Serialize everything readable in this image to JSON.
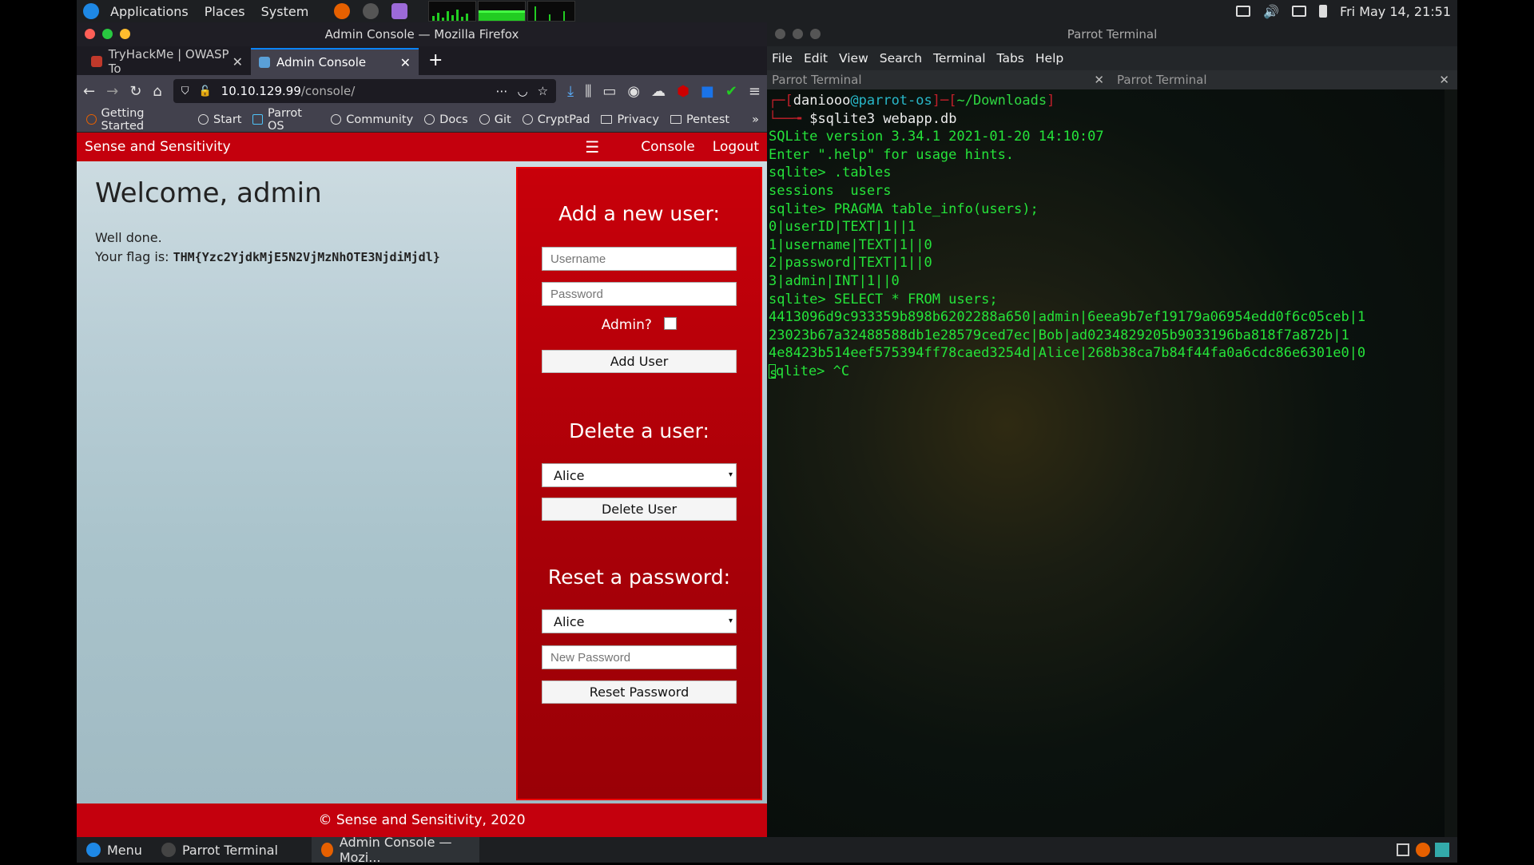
{
  "top_panel": {
    "menus": [
      "Applications",
      "Places",
      "System"
    ],
    "clock": "Fri May 14, 21:51"
  },
  "firefox": {
    "window_title": "Admin Console — Mozilla Firefox",
    "tabs": [
      {
        "label": "TryHackMe | OWASP To"
      },
      {
        "label": "Admin Console"
      }
    ],
    "url_host": "10.10.129.99",
    "url_path": "/console/",
    "bookmarks": [
      "Getting Started",
      "Start",
      "Parrot OS",
      "Community",
      "Docs",
      "Git",
      "CryptPad",
      "Privacy",
      "Pentest"
    ]
  },
  "site": {
    "brand": "Sense and Sensitivity",
    "nav_console": "Console",
    "nav_logout": "Logout",
    "welcome_title": "Welcome, admin",
    "well_done": "Well done.",
    "flag_label": "Your flag is: ",
    "flag_value": "THM{Yzc2YjdkMjE5N2VjMzNhOTE3NjdiMjdl}",
    "add_title": "Add a new user:",
    "username_placeholder": "Username",
    "password_placeholder": "Password",
    "admin_label": "Admin?",
    "add_button": "Add User",
    "delete_title": "Delete a user:",
    "delete_select": "Alice",
    "delete_button": "Delete User",
    "reset_title": "Reset a password:",
    "reset_select": "Alice",
    "new_password_placeholder": "New Password",
    "reset_button": "Reset Password",
    "footer": "© Sense and Sensitivity, 2020"
  },
  "terminal": {
    "window_title": "Parrot Terminal",
    "menu": [
      "File",
      "Edit",
      "View",
      "Search",
      "Terminal",
      "Tabs",
      "Help"
    ],
    "tabs": [
      "Parrot Terminal",
      "Parrot Terminal"
    ],
    "prompt_user": "daniooo",
    "prompt_host": "parrot-os",
    "prompt_dir": "~/Downloads",
    "command": "sqlite3 webapp.db",
    "lines": [
      "SQLite version 3.34.1 2021-01-20 14:10:07",
      "Enter \".help\" for usage hints.",
      "sqlite> .tables",
      "sessions  users",
      "sqlite> PRAGMA table_info(users);",
      "0|userID|TEXT|1||1",
      "1|username|TEXT|1||0",
      "2|password|TEXT|1||0",
      "3|admin|INT|1||0",
      "sqlite> SELECT * FROM users;",
      "4413096d9c933359b898b6202288a650|admin|6eea9b7ef19179a06954edd0f6c05ceb|1",
      "23023b67a32488588db1e28579ced7ec|Bob|ad0234829205b9033196ba818f7a872b|1",
      "4e8423b514eef575394ff78caed3254d|Alice|268b38ca7b84f44fa0a6cdc86e6301e0|0"
    ],
    "last_line": "qlite> ^C"
  },
  "taskbar": {
    "menu": "Menu",
    "items": [
      "Parrot Terminal",
      "Admin Console — Mozi..."
    ]
  }
}
